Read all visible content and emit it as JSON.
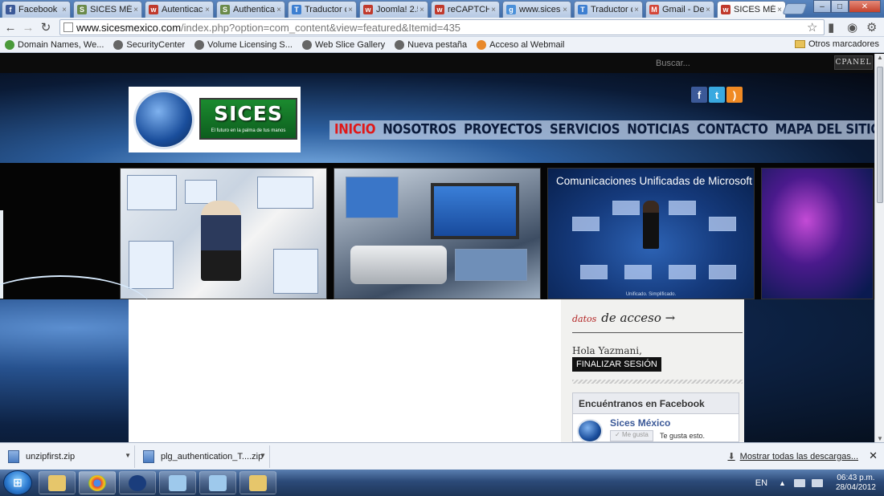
{
  "browser": {
    "tabs": [
      {
        "label": "Facebook",
        "icon": "facebook-favicon",
        "color": "#3b5998",
        "glyph": "f"
      },
      {
        "label": "SICES MÉXI",
        "icon": "sices-favicon",
        "color": "#6a8a4a",
        "glyph": "S"
      },
      {
        "label": "Autenticac",
        "icon": "joomla-favicon",
        "color": "#c0392b",
        "glyph": "w"
      },
      {
        "label": "Authenticat",
        "icon": "sices-favicon",
        "color": "#6a8a4a",
        "glyph": "S"
      },
      {
        "label": "Traductor c",
        "icon": "translate-favicon",
        "color": "#3d7fd1",
        "glyph": "T"
      },
      {
        "label": "Joomla! 2.5",
        "icon": "joomla-favicon",
        "color": "#c0392b",
        "glyph": "w"
      },
      {
        "label": "reCAPTCHA",
        "icon": "joomla-favicon",
        "color": "#c0392b",
        "glyph": "w"
      },
      {
        "label": "www.sicesn",
        "icon": "google-favicon",
        "color": "#4a90d9",
        "glyph": "g"
      },
      {
        "label": "Traductor c",
        "icon": "translate-favicon",
        "color": "#3d7fd1",
        "glyph": "T"
      },
      {
        "label": "Gmail - Del",
        "icon": "gmail-favicon",
        "color": "#d44638",
        "glyph": "M"
      },
      {
        "label": "SICES MÉXI",
        "icon": "joomla-favicon",
        "color": "#c0392b",
        "glyph": "w",
        "active": true
      }
    ],
    "window_buttons": {
      "minimize": "–",
      "maximize": "□",
      "close": "✕"
    },
    "url": {
      "domain": "www.sicesmexico.com",
      "path": "/index.php?option=com_content&view=featured&Itemid=435"
    },
    "bookmarks": [
      {
        "label": "Domain Names, We...",
        "icon": "godaddy-icon"
      },
      {
        "label": "SecurityCenter",
        "icon": "globe-icon"
      },
      {
        "label": "Volume Licensing S...",
        "icon": "windows-icon"
      },
      {
        "label": "Web Slice Gallery",
        "icon": "globe-icon"
      },
      {
        "label": "Nueva pestaña",
        "icon": "globe-icon"
      },
      {
        "label": "Acceso al Webmail",
        "icon": "cpanel-icon"
      }
    ],
    "other_bookmarks": "Otros marcadores"
  },
  "site": {
    "search_placeholder": "Buscar...",
    "cpanel_label": "CPANEL",
    "logo_title": "SICES",
    "logo_tagline": "El futuro en la palma de tus manos",
    "social": [
      {
        "name": "facebook-icon",
        "glyph": "f"
      },
      {
        "name": "twitter-icon",
        "glyph": "t"
      },
      {
        "name": "rss-icon",
        "glyph": ")"
      }
    ],
    "nav": [
      {
        "label": "INICIO",
        "active": true
      },
      {
        "label": "NOSOTROS"
      },
      {
        "label": "PROYECTOS"
      },
      {
        "label": "SERVICIOS"
      },
      {
        "label": "NOTICIAS"
      },
      {
        "label": "CONTACTO"
      },
      {
        "label": "MAPA DEL SITIO"
      }
    ],
    "slider": {
      "slide3_caption": "Comunicaciones Unificadas de Microsoft",
      "slide3_footer": "Unificado. Simplificado."
    },
    "login": {
      "title_small": "datos",
      "title_big": "de acceso →",
      "greeting": "Hola Yazmani,",
      "logout_label": "FINALIZAR SESIÓN"
    },
    "facebook_box": {
      "heading": "Encuéntranos en Facebook",
      "page_name": "Sices México",
      "like_label": "Me gusta",
      "like_text": "Te gusta esto."
    }
  },
  "downloads": {
    "items": [
      {
        "label": "unzipfirst.zip"
      },
      {
        "label": "plg_authentication_T....zip"
      }
    ],
    "show_all": "Mostrar todas las descargas...",
    "close": "✕"
  },
  "taskbar": {
    "language": "EN",
    "time": "06:43 p.m.",
    "date": "28/04/2012"
  }
}
